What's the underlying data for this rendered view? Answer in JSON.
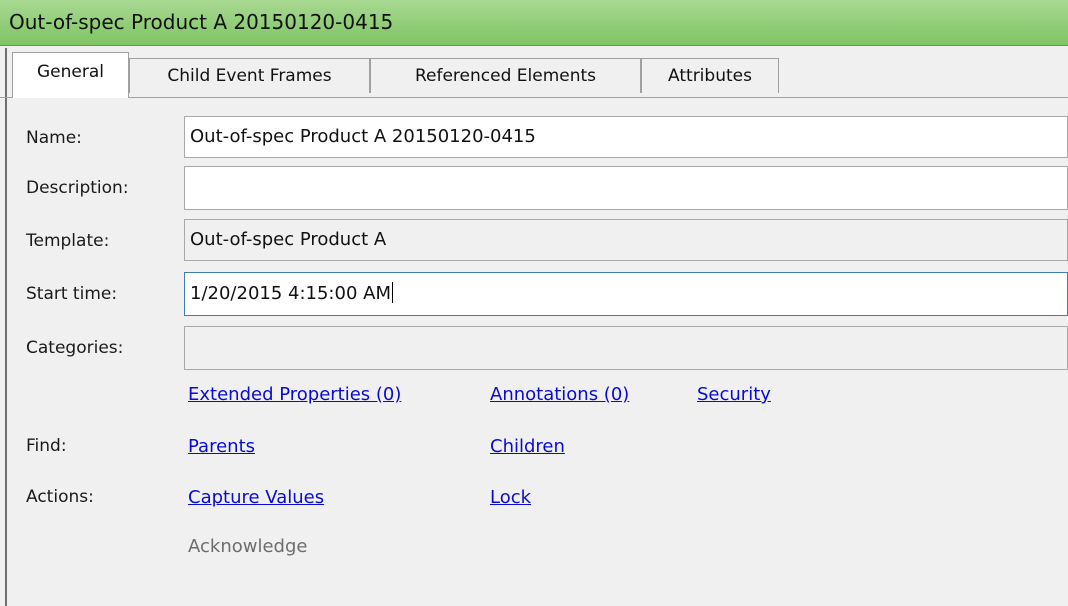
{
  "window": {
    "title": "Out-of-spec Product A 20150120-0415"
  },
  "tabs": [
    {
      "label": "General",
      "active": true
    },
    {
      "label": "Child Event Frames",
      "active": false
    },
    {
      "label": "Referenced Elements",
      "active": false
    },
    {
      "label": "Attributes",
      "active": false
    }
  ],
  "general": {
    "name": {
      "label": "Name:",
      "value": "Out-of-spec Product A 20150120-0415"
    },
    "description": {
      "label": "Description:",
      "value": ""
    },
    "template": {
      "label": "Template:",
      "value": "Out-of-spec Product A"
    },
    "start_time": {
      "label": "Start time:",
      "value": "1/20/2015 4:15:00 AM"
    },
    "categories": {
      "label": "Categories:",
      "value": ""
    }
  },
  "links": {
    "extended_properties": "Extended Properties (0)",
    "annotations": "Annotations (0)",
    "security": "Security"
  },
  "find": {
    "label": "Find:",
    "parents": "Parents",
    "children": "Children"
  },
  "actions": {
    "label": "Actions:",
    "capture_values": "Capture Values",
    "lock": "Lock",
    "acknowledge": "Acknowledge"
  },
  "colors": {
    "title_bar": "#8fcd74",
    "link": "#0a0ad6",
    "disabled_text": "#6d6d6d",
    "focus_border": "#3c7fb1"
  }
}
